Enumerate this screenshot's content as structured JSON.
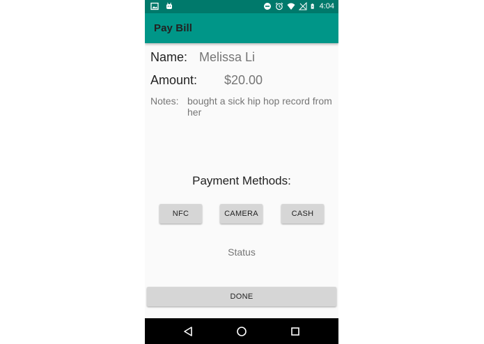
{
  "status_bar": {
    "time": "4:04",
    "left_icons": [
      "image-icon",
      "android-icon"
    ],
    "right_icons": [
      "do-not-disturb-icon",
      "alarm-icon",
      "wifi-icon",
      "no-signal-icon",
      "battery-charging-icon"
    ]
  },
  "app_bar": {
    "title": "Pay Bill"
  },
  "bill": {
    "name_label": "Name:",
    "name_value": "Melissa Li",
    "amount_label": "Amount:",
    "amount_value": "$20.00",
    "notes_label": "Notes:",
    "notes_value": "bought a sick hip hop record from her"
  },
  "payment": {
    "title": "Payment Methods:",
    "methods": [
      {
        "label": "NFC"
      },
      {
        "label": "CAMERA"
      },
      {
        "label": "CASH"
      }
    ]
  },
  "status_text": "Status",
  "done_label": "DONE",
  "navigation": {
    "icons": [
      "back-icon",
      "home-icon",
      "recents-icon"
    ]
  },
  "colors": {
    "status_bar": "#00796b",
    "app_bar": "#009688",
    "background": "#fafafa",
    "button": "#d6d6d6",
    "nav_bar": "#000000"
  }
}
